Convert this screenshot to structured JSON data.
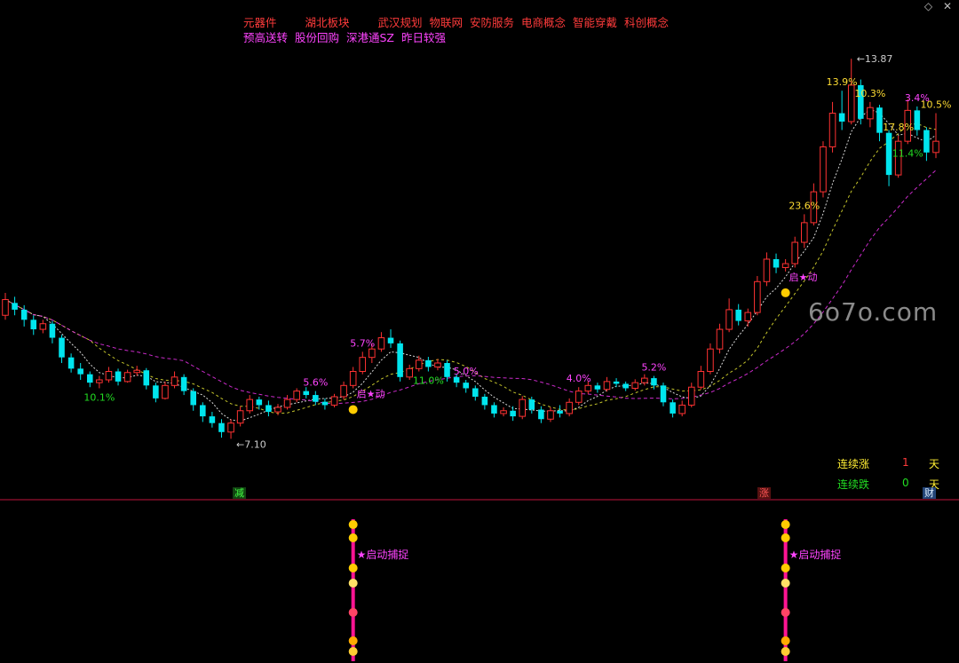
{
  "top_icons": [
    "diamond-icon",
    "close-icon"
  ],
  "concepts": {
    "row1": [
      "元器件",
      "湖北板块",
      "武汉规划",
      "物联网",
      "安防服务",
      "电商概念",
      "智能穿戴",
      "科创概念"
    ],
    "row2": [
      "预高送转",
      "股份回购",
      "深港通SZ",
      "昨日较强"
    ]
  },
  "watermark": "6o7o.com",
  "stats": {
    "up_label": "连续涨",
    "up_value": "1",
    "up_unit": "天",
    "down_label": "连续跌",
    "down_value": "0",
    "down_unit": "天"
  },
  "badges": {
    "jian": "减",
    "zhang": "涨",
    "cai": "财"
  },
  "signals": {
    "start": "启★动",
    "capture": "★启动捕捉"
  },
  "chart_data": {
    "type": "candlestick",
    "ylim": [
      6.3,
      14.6
    ],
    "x_count": 100,
    "high_marker": "13.87",
    "low_marker": "7.10",
    "candles": [
      [
        9.3,
        9.58,
        9.7,
        9.22
      ],
      [
        9.52,
        9.4,
        9.63,
        9.3
      ],
      [
        9.4,
        9.22,
        9.48,
        9.1
      ],
      [
        9.22,
        9.05,
        9.3,
        8.95
      ],
      [
        9.05,
        9.15,
        9.22,
        8.98
      ],
      [
        9.15,
        8.9,
        9.2,
        8.8
      ],
      [
        8.9,
        8.55,
        8.95,
        8.45
      ],
      [
        8.55,
        8.35,
        8.62,
        8.28
      ],
      [
        8.35,
        8.25,
        8.45,
        8.15
      ],
      [
        8.25,
        8.1,
        8.3,
        8.02
      ],
      [
        8.1,
        8.15,
        8.22,
        8.0
      ],
      [
        8.15,
        8.3,
        8.38,
        8.1
      ],
      [
        8.3,
        8.12,
        8.35,
        8.05
      ],
      [
        8.12,
        8.28,
        8.33,
        8.1
      ],
      [
        8.28,
        8.32,
        8.4,
        8.22
      ],
      [
        8.32,
        8.05,
        8.36,
        7.98
      ],
      [
        8.05,
        7.82,
        8.1,
        7.75
      ],
      [
        7.82,
        8.05,
        8.12,
        7.8
      ],
      [
        8.05,
        8.2,
        8.3,
        8.0
      ],
      [
        8.2,
        7.95,
        8.25,
        7.88
      ],
      [
        7.95,
        7.7,
        8.0,
        7.6
      ],
      [
        7.7,
        7.5,
        7.75,
        7.4
      ],
      [
        7.5,
        7.38,
        7.58,
        7.3
      ],
      [
        7.38,
        7.22,
        7.45,
        7.12
      ],
      [
        7.22,
        7.38,
        7.45,
        7.1
      ],
      [
        7.38,
        7.6,
        7.68,
        7.32
      ],
      [
        7.6,
        7.8,
        7.88,
        7.55
      ],
      [
        7.8,
        7.7,
        7.85,
        7.62
      ],
      [
        7.7,
        7.58,
        7.78,
        7.5
      ],
      [
        7.58,
        7.66,
        7.72,
        7.52
      ],
      [
        7.66,
        7.8,
        7.88,
        7.62
      ],
      [
        7.8,
        7.95,
        8.0,
        7.75
      ],
      [
        7.95,
        7.88,
        8.02,
        7.82
      ],
      [
        7.88,
        7.76,
        7.95,
        7.7
      ],
      [
        7.76,
        7.7,
        7.82,
        7.62
      ],
      [
        7.7,
        7.85,
        7.9,
        7.66
      ],
      [
        7.85,
        8.05,
        8.12,
        7.8
      ],
      [
        8.05,
        8.3,
        8.38,
        8.0
      ],
      [
        8.3,
        8.55,
        8.65,
        8.25
      ],
      [
        8.55,
        8.7,
        8.8,
        8.45
      ],
      [
        8.7,
        8.9,
        9.0,
        8.65
      ],
      [
        8.9,
        8.8,
        9.05,
        8.72
      ],
      [
        8.8,
        8.2,
        8.85,
        8.12
      ],
      [
        8.2,
        8.35,
        8.42,
        8.15
      ],
      [
        8.35,
        8.5,
        8.58,
        8.3
      ],
      [
        8.5,
        8.38,
        8.56,
        8.3
      ],
      [
        8.38,
        8.45,
        8.52,
        8.32
      ],
      [
        8.45,
        8.2,
        8.5,
        8.12
      ],
      [
        8.2,
        8.1,
        8.25,
        8.02
      ],
      [
        8.1,
        8.0,
        8.15,
        7.92
      ],
      [
        8.0,
        7.85,
        8.05,
        7.78
      ],
      [
        7.85,
        7.7,
        7.9,
        7.62
      ],
      [
        7.7,
        7.55,
        7.75,
        7.48
      ],
      [
        7.55,
        7.6,
        7.66,
        7.5
      ],
      [
        7.6,
        7.5,
        7.68,
        7.42
      ],
      [
        7.5,
        7.8,
        7.86,
        7.45
      ],
      [
        7.8,
        7.62,
        7.85,
        7.55
      ],
      [
        7.62,
        7.45,
        7.68,
        7.38
      ],
      [
        7.45,
        7.6,
        7.66,
        7.4
      ],
      [
        7.6,
        7.55,
        7.7,
        7.48
      ],
      [
        7.55,
        7.75,
        7.82,
        7.5
      ],
      [
        7.75,
        7.95,
        8.02,
        7.7
      ],
      [
        7.95,
        8.05,
        8.12,
        7.9
      ],
      [
        8.05,
        7.98,
        8.1,
        7.92
      ],
      [
        7.98,
        8.12,
        8.2,
        7.94
      ],
      [
        8.12,
        8.08,
        8.18,
        8.02
      ],
      [
        8.08,
        8.0,
        8.12,
        7.95
      ],
      [
        8.0,
        8.1,
        8.16,
        7.96
      ],
      [
        8.1,
        8.18,
        8.25,
        8.05
      ],
      [
        8.18,
        8.05,
        8.22,
        7.98
      ],
      [
        8.05,
        7.75,
        8.1,
        7.68
      ],
      [
        7.75,
        7.55,
        7.8,
        7.48
      ],
      [
        7.55,
        7.7,
        7.78,
        7.5
      ],
      [
        7.7,
        8.02,
        8.1,
        7.66
      ],
      [
        8.02,
        8.3,
        8.4,
        7.98
      ],
      [
        8.3,
        8.7,
        8.8,
        8.25
      ],
      [
        8.7,
        9.05,
        9.15,
        8.62
      ],
      [
        9.05,
        9.4,
        9.6,
        9.0
      ],
      [
        9.4,
        9.2,
        9.5,
        9.12
      ],
      [
        9.2,
        9.35,
        9.42,
        9.1
      ],
      [
        9.35,
        9.9,
        10.0,
        9.3
      ],
      [
        9.9,
        10.3,
        10.42,
        9.82
      ],
      [
        10.3,
        10.15,
        10.4,
        10.05
      ],
      [
        10.15,
        10.22,
        10.3,
        10.08
      ],
      [
        10.22,
        10.6,
        10.7,
        10.15
      ],
      [
        10.6,
        10.95,
        11.1,
        10.5
      ],
      [
        10.95,
        11.5,
        11.65,
        10.9
      ],
      [
        11.5,
        12.3,
        12.4,
        11.4
      ],
      [
        12.3,
        12.9,
        13.1,
        12.2
      ],
      [
        12.9,
        12.75,
        13.3,
        12.6
      ],
      [
        12.75,
        13.4,
        13.87,
        12.7
      ],
      [
        13.4,
        12.8,
        13.5,
        12.7
      ],
      [
        12.8,
        13.0,
        13.1,
        12.65
      ],
      [
        13.0,
        12.55,
        13.05,
        12.4
      ],
      [
        12.55,
        11.8,
        12.6,
        11.6
      ],
      [
        11.8,
        12.4,
        12.5,
        11.75
      ],
      [
        12.4,
        12.95,
        13.15,
        12.35
      ],
      [
        12.95,
        12.6,
        13.02,
        12.5
      ],
      [
        12.6,
        12.2,
        12.65,
        12.05
      ],
      [
        12.2,
        12.4,
        12.9,
        12.1
      ]
    ],
    "labels": [
      {
        "i": 10,
        "text": "10.1%",
        "color": "#22dd22",
        "side": "below"
      },
      {
        "i": 33,
        "text": "5.6%",
        "color": "#ff44ff",
        "side": "above"
      },
      {
        "i": 38,
        "text": "5.7%",
        "color": "#ff44ff",
        "side": "above"
      },
      {
        "i": 45,
        "text": "11.0%",
        "color": "#22dd22",
        "side": "below"
      },
      {
        "i": 49,
        "text": "5.0%",
        "color": "#ff44ff",
        "side": "above"
      },
      {
        "i": 61,
        "text": "4.0%",
        "color": "#ff44ff",
        "side": "above"
      },
      {
        "i": 69,
        "text": "5.2%",
        "color": "#ff44ff",
        "side": "above"
      },
      {
        "i": 85,
        "text": "23.6%",
        "color": "#ffdd33",
        "side": "above"
      },
      {
        "i": 89,
        "text": "13.9%",
        "color": "#ffdd33",
        "side": "above"
      },
      {
        "i": 92,
        "text": "10.3%",
        "color": "#ffdd33",
        "side": "above"
      },
      {
        "i": 95,
        "text": "17.8%",
        "color": "#ffdd33",
        "side": "above"
      },
      {
        "i": 97,
        "text": "3.4%",
        "color": "#ff44ff",
        "side": "above"
      },
      {
        "i": 99,
        "text": "10.5%",
        "color": "#ffdd33",
        "side": "above"
      },
      {
        "i": 96,
        "text": "11.4%",
        "color": "#22dd22",
        "side": "below"
      }
    ]
  }
}
